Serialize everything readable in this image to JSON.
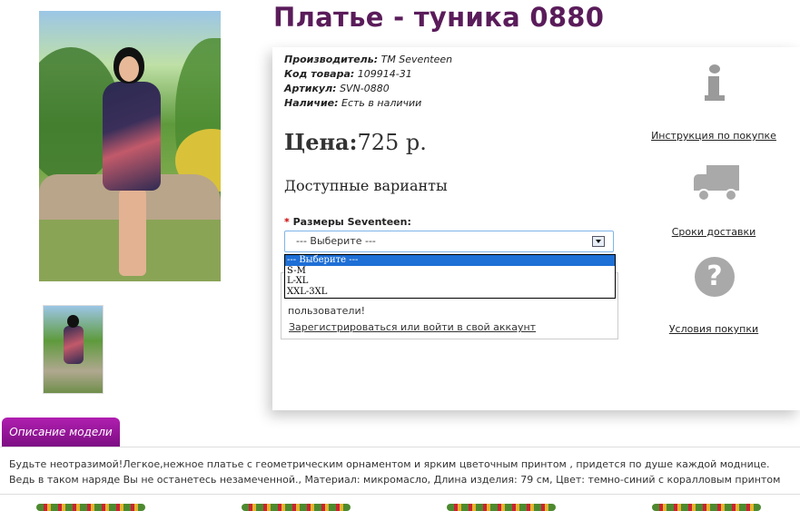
{
  "product": {
    "title": "Платье - туника 0880",
    "meta": [
      {
        "label": "Производитель:",
        "value": "TM Seventeen"
      },
      {
        "label": "Код товара:",
        "value": "109914-31"
      },
      {
        "label": "Артикул:",
        "value": "SVN-0880"
      },
      {
        "label": "Наличие:",
        "value": "Есть в наличии"
      }
    ],
    "price_label": "Цена:",
    "price_value": "725 р.",
    "variants_title": "Доступные варианты",
    "size": {
      "required_mark": "*",
      "label": "Размеры Seventeen:",
      "selected": "--- Выберите ---",
      "options": [
        "--- Выберите ---",
        "S-M",
        "L-XL",
        "XXL-3XL"
      ]
    },
    "login_note": "пользователи!",
    "login_link": "Зарегистрироваться или войти в свой аккаунт"
  },
  "side": {
    "instruction": "Инструкция по покупке",
    "delivery": "Сроки доставки",
    "terms": "Условия покупки",
    "help_glyph": "?"
  },
  "description": {
    "tab": "Описание модели",
    "text": "Будьте неотразимой!Легкое,нежное платье с геометрическим орнаментом и ярким цветочным принтом , придется по душе каждой моднице. Ведь в таком наряде Вы не останетесь незамеченной., Материал: микромасло, Длина изделия: 79 см, Цвет: темно-синий с коралловым принтом"
  },
  "colors": {
    "title": "#5a1c5a",
    "tab": "#9a179f",
    "dropdown_selected": "#1e6fd6"
  }
}
